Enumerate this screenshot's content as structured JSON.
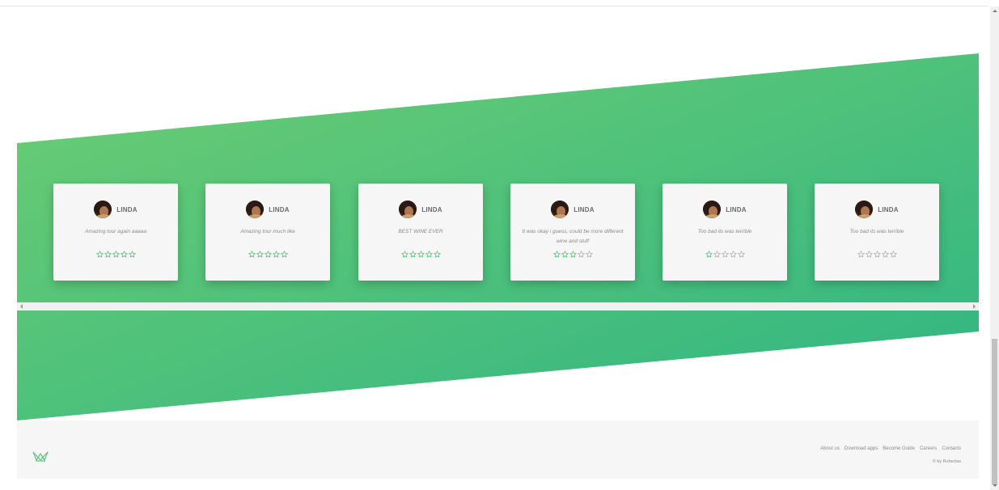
{
  "colors": {
    "band_start": "#6dcd73",
    "band_end": "#2fb583",
    "star": "#5ec57d",
    "star_empty": "#b5b5b5",
    "logo": "#5ec57d"
  },
  "reviews": [
    {
      "name": "LINDA",
      "comment": "Amazing tour again aaaaa",
      "rating": 5
    },
    {
      "name": "LINDA",
      "comment": "Amazing tour much like",
      "rating": 5
    },
    {
      "name": "LINDA",
      "comment": "BEST WINE EVER",
      "rating": 5
    },
    {
      "name": "LINDA",
      "comment": "It was okay i guess, could be more different wine and stuff",
      "rating": 3
    },
    {
      "name": "LINDA",
      "comment": "Too bad its was terrible",
      "rating": 1
    },
    {
      "name": "LINDA",
      "comment": "Too bad its was terrible",
      "rating": 0
    }
  ],
  "footer": {
    "links": [
      "About us",
      "Download apps",
      "Become Guide",
      "Careers",
      "Contacts"
    ],
    "copyright": "© by Robertas",
    "logo_icon": "crown-logo-icon"
  }
}
